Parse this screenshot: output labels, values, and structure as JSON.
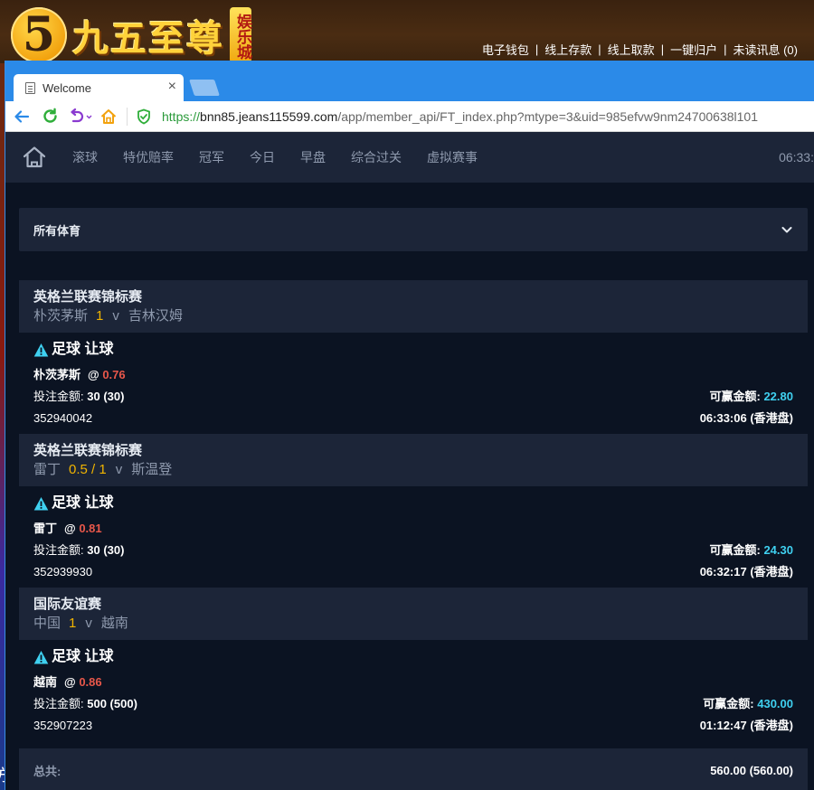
{
  "site": {
    "logo_digit": "5",
    "logo_text": "九五至尊",
    "logo_sub": "娱乐城",
    "links": [
      "电子钱包",
      "线上存款",
      "线上取款",
      "一键归户",
      "未读讯息 (0)"
    ],
    "left_glyph": "方"
  },
  "browser": {
    "tab_title": "Welcome",
    "tab_close": "×",
    "url_scheme": "https://",
    "url_host": "bnn85.jeans115599.com",
    "url_path": "/app/member_api/FT_index.php?mtype=3&uid=985efvw9nm24700638l101"
  },
  "nav": {
    "items": [
      "滚球",
      "特优赔率",
      "冠军",
      "今日",
      "早盘",
      "综合过关",
      "虚拟赛事"
    ],
    "clock": "06:33:"
  },
  "filter": {
    "label": "所有体育"
  },
  "bets": [
    {
      "league": "英格兰联赛锦标赛",
      "home": "朴茨茅斯",
      "handicap": "1",
      "vs": "v",
      "away": "吉林汉姆",
      "type": "足球 让球",
      "pick": "朴茨茅斯",
      "at": "@",
      "odds": "0.76",
      "stake_label": "投注金额:",
      "stake": "30 (30)",
      "win_label": "可赢金额:",
      "win": "22.80",
      "ticket": "352940042",
      "time": "06:33:06 (香港盘)"
    },
    {
      "league": "英格兰联赛锦标赛",
      "home": "雷丁",
      "handicap": "0.5 / 1",
      "vs": "v",
      "away": "斯温登",
      "type": "足球 让球",
      "pick": "雷丁",
      "at": "@",
      "odds": "0.81",
      "stake_label": "投注金额:",
      "stake": "30 (30)",
      "win_label": "可赢金额:",
      "win": "24.30",
      "ticket": "352939930",
      "time": "06:32:17 (香港盘)"
    },
    {
      "league": "国际友谊赛",
      "home": "中国",
      "handicap": "1",
      "vs": "v",
      "away": "越南",
      "type": "足球 让球",
      "pick": "越南",
      "at": "@",
      "odds": "0.86",
      "stake_label": "投注金额:",
      "stake": "500 (500)",
      "win_label": "可赢金额:",
      "win": "430.00",
      "ticket": "352907223",
      "time": "01:12:47 (香港盘)"
    }
  ],
  "total": {
    "label": "总共:",
    "value": "560.00 (560.00)"
  },
  "colors": {
    "brand_gold": "#ffd23a",
    "browser_blue": "#2b8ae8",
    "panel": "#1c2538",
    "background": "#0b1322",
    "odds_red": "#e8574a",
    "win_cyan": "#3fd0f0",
    "handicap_yellow": "#f0b400"
  },
  "icons": {
    "home": "home-icon",
    "warning": "warning-icon",
    "dropdown": "chevron-down-icon",
    "back": "back-arrow-icon",
    "refresh": "refresh-icon",
    "undo": "undo-icon",
    "home_browser": "home-outline-icon",
    "secure": "shield-check-icon"
  }
}
